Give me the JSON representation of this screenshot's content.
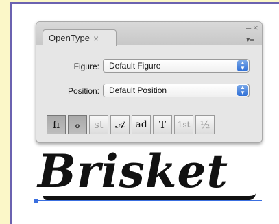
{
  "panel": {
    "tab_label": "OpenType",
    "tab_close": "×",
    "minimize": "–",
    "close": "×",
    "menu": "▾≡"
  },
  "figure": {
    "label": "Figure:",
    "value": "Default Figure"
  },
  "position": {
    "label": "Position:",
    "value": "Default Position"
  },
  "glyph_buttons": [
    {
      "label": "fi",
      "state": "on"
    },
    {
      "label": "ℴ",
      "state": "on"
    },
    {
      "label": "st",
      "state": "dim"
    },
    {
      "label": "𝒜",
      "state": "normal"
    },
    {
      "label": "ad",
      "state": "normal"
    },
    {
      "label": "T",
      "state": "normal"
    },
    {
      "label": "1st",
      "state": "dim"
    },
    {
      "label": "½",
      "state": "dim"
    }
  ],
  "sample": {
    "text": "Brisket"
  },
  "colors": {
    "select_accent": "#2f6fd6",
    "baseline": "#3a6fe0",
    "page_background": "#fbf7c8",
    "frame_border": "#6b62b0"
  }
}
